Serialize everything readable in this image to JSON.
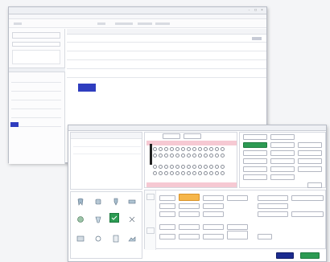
{
  "back_window": {
    "title": "",
    "bluebar_label": ""
  },
  "front_window": {
    "title": "",
    "patient_list_labels": [
      "",
      "",
      "",
      ""
    ],
    "tabs": [
      "",
      ""
    ],
    "confirm_label": "",
    "cancel_label": ""
  },
  "colors": {
    "accent_blue": "#2f3dbf",
    "accent_green": "#2d9b53",
    "accent_orange": "#f6b64a",
    "accent_navy": "#1c2c8f",
    "tooth_row_pink": "#f6c9d3"
  }
}
